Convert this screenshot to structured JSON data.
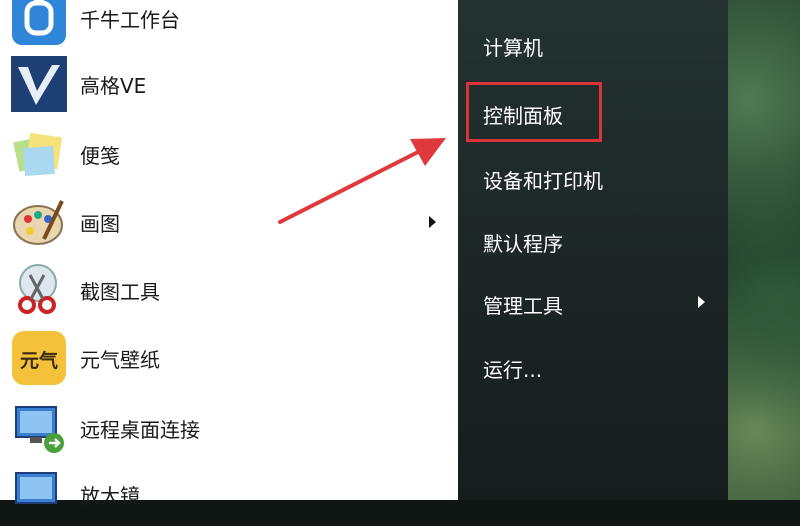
{
  "left_panel": {
    "programs": [
      {
        "label": "千牛工作台",
        "icon": "qianniu-icon",
        "has_arrow": false
      },
      {
        "label": "高格VE",
        "icon": "gaoge-ve-icon",
        "has_arrow": false
      },
      {
        "label": "便笺",
        "icon": "sticky-notes-icon",
        "has_arrow": false
      },
      {
        "label": "画图",
        "icon": "paint-palette-icon",
        "has_arrow": true
      },
      {
        "label": "截图工具",
        "icon": "scissors-icon",
        "has_arrow": false
      },
      {
        "label": "元气壁纸",
        "icon": "yuanqi-wallpaper-icon",
        "has_arrow": false
      },
      {
        "label": "远程桌面连接",
        "icon": "remote-desktop-icon",
        "has_arrow": false
      },
      {
        "label": "放大镜",
        "icon": "magnifier-icon",
        "has_arrow": false
      }
    ],
    "yuanqi_icon_text": "元气"
  },
  "right_panel": {
    "items": [
      {
        "label": "计算机",
        "has_arrow": false
      },
      {
        "label": "控制面板",
        "has_arrow": false,
        "highlighted": true
      },
      {
        "label": "设备和打印机",
        "has_arrow": false
      },
      {
        "label": "默认程序",
        "has_arrow": false
      },
      {
        "label": "管理工具",
        "has_arrow": true
      },
      {
        "label": "运行...",
        "has_arrow": false
      }
    ]
  },
  "colors": {
    "highlight_border": "#d9343a",
    "annotation_arrow": "#e0393d",
    "right_panel_bg": "#1f2a2a"
  }
}
